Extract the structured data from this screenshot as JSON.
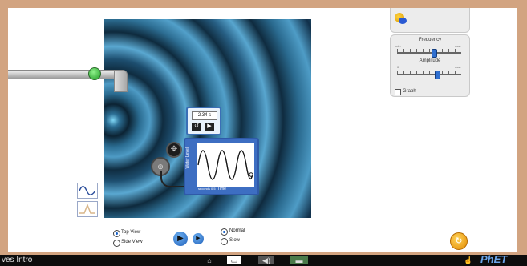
{
  "app": {
    "title": "ves Intro"
  },
  "controls": {
    "frequency_label": "Frequency",
    "amplitude_label": "Amplitude",
    "freq_min": "min",
    "freq_max": "max",
    "amp_min": "0",
    "amp_max": "max",
    "graph_label": "Graph",
    "frequency_level": 0.58,
    "amplitude_level": 0.62,
    "graph_checked": false
  },
  "stopwatch": {
    "time": "2.34 s"
  },
  "graph": {
    "y_label": "Water Level",
    "x_label": "Time",
    "scale_label": "seconds 0.5"
  },
  "view": {
    "top_view": "Top View",
    "side_view": "Side View",
    "selected": "Top View"
  },
  "speed": {
    "normal": "Normal",
    "slow": "Slow",
    "selected": "Normal"
  },
  "icons": {
    "faucet": "faucet-icon",
    "play": "play-icon",
    "step": "step-icon",
    "reset": "reset-icon",
    "rewind": "rewind-icon",
    "probe": "probe-icon",
    "crosshair": "crosshair-icon"
  },
  "colors": {
    "frame": "#d2a481",
    "wave_dark": "#0c2333",
    "wave_light": "#5aa8d1",
    "accent": "#2f6fd0"
  },
  "branding": {
    "logo": "PhET"
  }
}
